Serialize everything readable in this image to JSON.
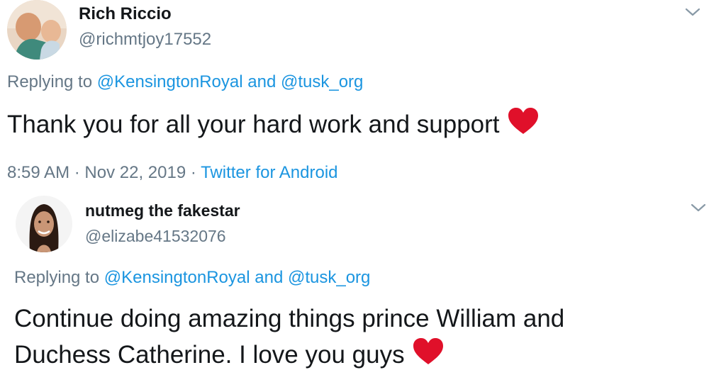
{
  "tweets": [
    {
      "display_name": "Rich Riccio",
      "handle": "@richmtjoy17552",
      "replying_prefix": "Replying to",
      "mention_1": "@KensingtonRoyal",
      "and_word": "and",
      "mention_2": "@tusk_org",
      "text": "Thank you for all your hard work and support",
      "emoji": "heart-emoji",
      "time": "8:59 AM",
      "separator": "·",
      "date": "Nov 22, 2019",
      "source": "Twitter for Android"
    },
    {
      "display_name": "nutmeg the fakestar",
      "handle": "@elizabe41532076",
      "replying_prefix": "Replying to",
      "mention_1": "@KensingtonRoyal",
      "and_word": "and",
      "mention_2": "@tusk_org",
      "line_1": "Continue doing amazing things prince William and",
      "line_2": "Duchess Catherine. I love you guys",
      "emoji": "heart-emoji"
    }
  ],
  "colors": {
    "text": "#14171a",
    "secondary": "#657786",
    "link": "#1b95e0",
    "heart": "#e0102a"
  }
}
